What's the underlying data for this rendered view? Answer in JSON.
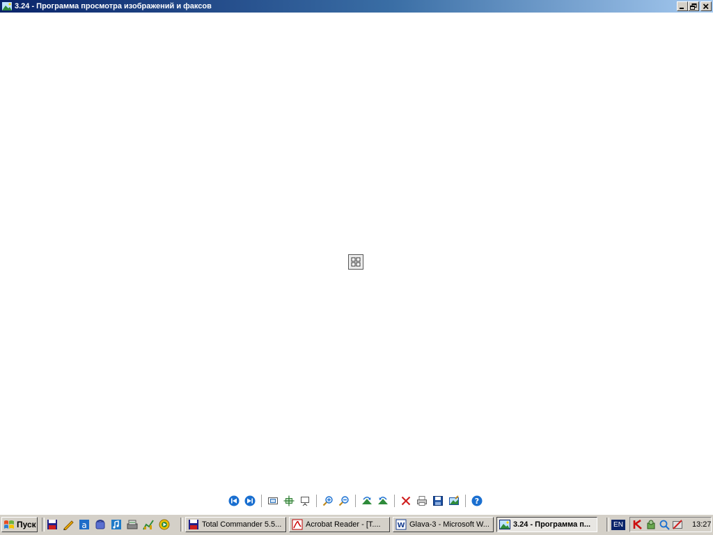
{
  "window": {
    "title": "3.24 - Программа просмотра изображений и факсов",
    "controls": [
      "minimize-icon",
      "restore-icon",
      "close-icon"
    ]
  },
  "viewer": {
    "placeholder_icon": "thumbnail-grid-icon"
  },
  "toolbar": {
    "groups": [
      [
        "previous-image-icon",
        "next-image-icon"
      ],
      [
        "best-fit-icon",
        "actual-size-icon",
        "slideshow-icon"
      ],
      [
        "zoom-in-icon",
        "zoom-out-icon"
      ],
      [
        "rotate-clockwise-icon",
        "rotate-counterclockwise-icon"
      ],
      [
        "delete-icon",
        "print-icon",
        "save-icon",
        "open-for-editing-icon"
      ],
      [
        "help-icon"
      ]
    ]
  },
  "taskbar": {
    "start_label": "Пуск",
    "quick_launch": [
      "total-commander-icon",
      "pencil-icon",
      "acrobat-a-icon",
      "phone-icon",
      "music-icon",
      "scanner-icon",
      "chart-icon",
      "media-player-icon"
    ],
    "tasks": [
      {
        "label": "Total Commander 5.5...",
        "icon": "total-commander-icon",
        "active": false
      },
      {
        "label": "Acrobat Reader - [T....",
        "icon": "acrobat-icon",
        "active": false
      },
      {
        "label": "Glava-3 - Microsoft W...",
        "icon": "word-icon",
        "active": false
      },
      {
        "label": "3.24 - Программа п...",
        "icon": "image-viewer-icon",
        "active": true
      }
    ],
    "language": "EN",
    "tray_icons": [
      "kaspersky-icon",
      "network-icon",
      "search-icon",
      "disconnected-icon"
    ],
    "clock": "13:27"
  },
  "colors": {
    "titlebar_start": "#0a246a",
    "titlebar_end": "#a6caf0",
    "taskbar_bg": "#d4d0c8",
    "canvas_bg": "#ffffff"
  }
}
